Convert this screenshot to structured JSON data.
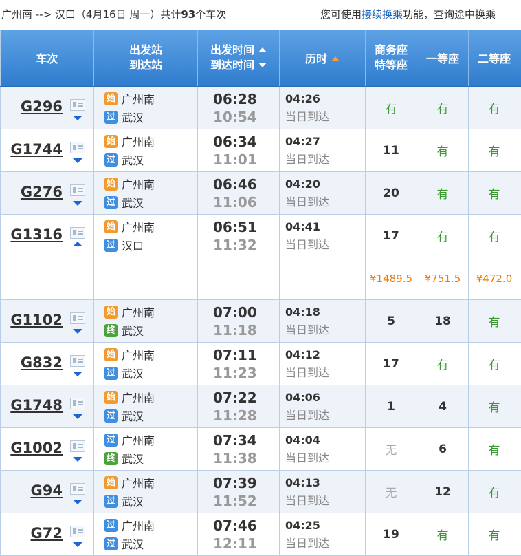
{
  "topbar": {
    "route": "广州南 --> 汉口（4月16日  周一）共计",
    "count": "93",
    "count_suffix": "个车次",
    "hint_prefix": "您可使用",
    "hint_link": "接续换乘",
    "hint_suffix": "功能，查询途中换乘"
  },
  "header": {
    "train": "车次",
    "station_from": "出发站",
    "station_to": "到达站",
    "time_dep": "出发时间",
    "time_arr": "到达时间",
    "duration": "历时",
    "business_1": "商务座",
    "business_2": "特等座",
    "first": "一等座",
    "second": "二等座"
  },
  "rows": [
    {
      "no": "G296",
      "from_badge": "始",
      "from": "广州南",
      "to_badge": "过",
      "to": "武汉",
      "dep": "06:28",
      "arr": "10:54",
      "dur": "04:26",
      "day": "当日到达",
      "bus": "有",
      "first": "有",
      "second": "有"
    },
    {
      "no": "G1744",
      "from_badge": "始",
      "from": "广州南",
      "to_badge": "过",
      "to": "武汉",
      "dep": "06:34",
      "arr": "11:01",
      "dur": "04:27",
      "day": "当日到达",
      "bus": "11",
      "first": "有",
      "second": "有"
    },
    {
      "no": "G276",
      "from_badge": "始",
      "from": "广州南",
      "to_badge": "过",
      "to": "武汉",
      "dep": "06:46",
      "arr": "11:06",
      "dur": "04:20",
      "day": "当日到达",
      "bus": "20",
      "first": "有",
      "second": "有"
    },
    {
      "no": "G1316",
      "from_badge": "始",
      "from": "广州南",
      "to_badge": "过",
      "to": "汉口",
      "dep": "06:51",
      "arr": "11:32",
      "dur": "04:41",
      "day": "当日到达",
      "bus": "17",
      "first": "有",
      "second": "有"
    },
    {
      "no": "G1102",
      "from_badge": "始",
      "from": "广州南",
      "to_badge": "终",
      "to": "武汉",
      "dep": "07:00",
      "arr": "11:18",
      "dur": "04:18",
      "day": "当日到达",
      "bus": "5",
      "first": "18",
      "second": "有"
    },
    {
      "no": "G832",
      "from_badge": "始",
      "from": "广州南",
      "to_badge": "过",
      "to": "武汉",
      "dep": "07:11",
      "arr": "11:23",
      "dur": "04:12",
      "day": "当日到达",
      "bus": "17",
      "first": "有",
      "second": "有"
    },
    {
      "no": "G1748",
      "from_badge": "始",
      "from": "广州南",
      "to_badge": "过",
      "to": "武汉",
      "dep": "07:22",
      "arr": "11:28",
      "dur": "04:06",
      "day": "当日到达",
      "bus": "1",
      "first": "4",
      "second": "有"
    },
    {
      "no": "G1002",
      "from_badge": "过",
      "from": "广州南",
      "to_badge": "终",
      "to": "武汉",
      "dep": "07:34",
      "arr": "11:38",
      "dur": "04:04",
      "day": "当日到达",
      "bus": "无",
      "first": "6",
      "second": "有"
    },
    {
      "no": "G94",
      "from_badge": "始",
      "from": "广州南",
      "to_badge": "过",
      "to": "武汉",
      "dep": "07:39",
      "arr": "11:52",
      "dur": "04:13",
      "day": "当日到达",
      "bus": "无",
      "first": "12",
      "second": "有"
    },
    {
      "no": "G72",
      "from_badge": "过",
      "from": "广州南",
      "to_badge": "过",
      "to": "武汉",
      "dep": "07:46",
      "arr": "12:11",
      "dur": "04:25",
      "day": "当日到达",
      "bus": "19",
      "first": "有",
      "second": "有"
    }
  ],
  "price_row": {
    "bus": "¥1489.5",
    "first": "¥751.5",
    "second": "¥472.0"
  },
  "colors": {
    "header_top": "#5fa2e6",
    "header_bottom": "#2f7ccd",
    "available": "#3a9a2f",
    "price": "#f07800",
    "link": "#1a63b8"
  }
}
